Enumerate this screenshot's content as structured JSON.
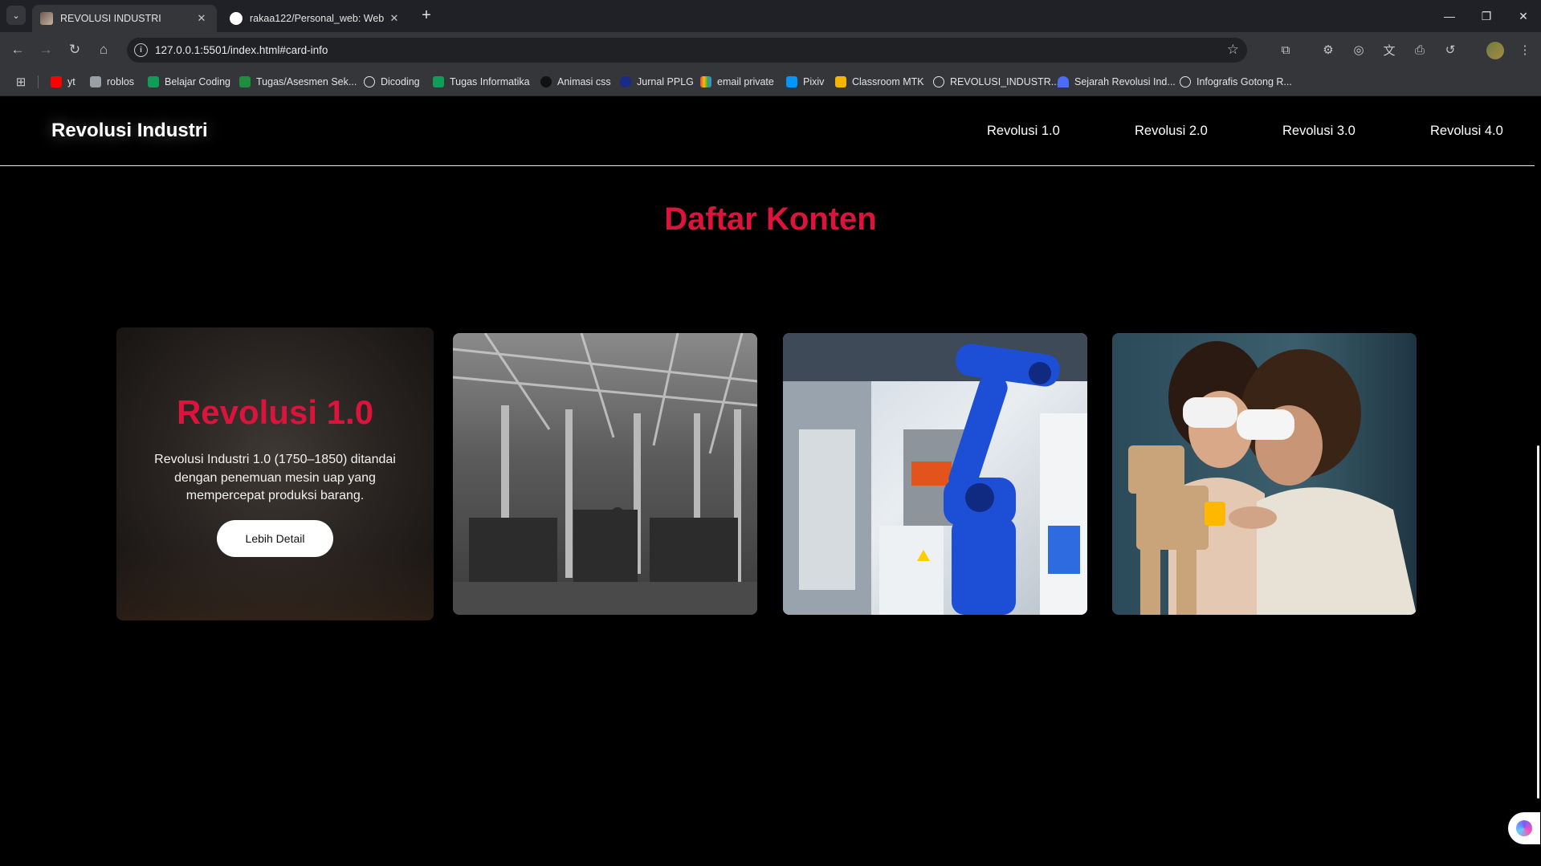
{
  "browser": {
    "tabs": [
      {
        "title": "REVOLUSI INDUSTRI",
        "active": true
      },
      {
        "title": "rakaa122/Personal_web: Web",
        "active": false
      }
    ],
    "url": "127.0.0.1:5501/index.html#card-info",
    "bookmarks": [
      "yt",
      "roblos",
      "Belajar Coding",
      "Tugas/Asesmen Sek...",
      "Dicoding",
      "Tugas Informatika",
      "Animasi css",
      "Jurnal PPLG",
      "email private",
      "Pixiv",
      "Classroom MTK",
      "REVOLUSI_INDUSTR...",
      "Sejarah Revolusi Ind...",
      "Infografis Gotong R..."
    ]
  },
  "site": {
    "brand": "Revolusi Industri",
    "nav": [
      "Revolusi 1.0",
      "Revolusi 2.0",
      "Revolusi 3.0",
      "Revolusi 4.0"
    ],
    "section_title": "Daftar Konten"
  },
  "cards": {
    "featured": {
      "title": "Revolusi 1.0",
      "text": "Revolusi Industri 1.0 (1750–1850) ditandai dengan penemuan mesin uap yang mempercepat produksi barang.",
      "button": "Lebih Detail"
    },
    "images": [
      {
        "name": "factory-photo-image"
      },
      {
        "name": "robot-arm-image"
      },
      {
        "name": "vr-robotics-image"
      }
    ]
  },
  "colors": {
    "accent": "#dc143c",
    "page_bg": "#000000",
    "chrome_bg": "#35363a"
  }
}
